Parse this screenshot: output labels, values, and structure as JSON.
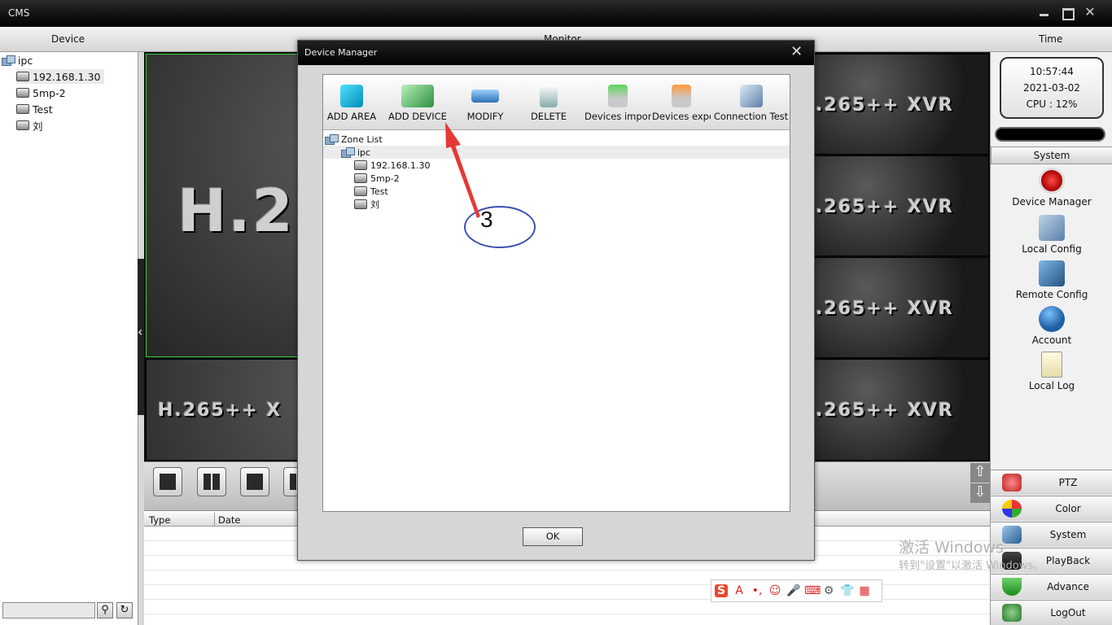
{
  "app": {
    "title": "CMS",
    "close_glyph": "✕"
  },
  "header": {
    "device": "Device",
    "monitor": "Monitor",
    "time": "Time"
  },
  "device_tree": {
    "root": "ipc",
    "items": [
      "192.168.1.30",
      "5mp-2",
      "Test",
      "刘"
    ]
  },
  "left_panel": {
    "search_icon": "search-icon",
    "refresh_icon": "refresh-icon"
  },
  "video_tiles": {
    "big_text": "H.2",
    "right_text": ".265++ XVR",
    "bottom_text": "H.265++ X"
  },
  "log_table": {
    "columns": [
      "Type",
      "Date"
    ]
  },
  "clock": {
    "time": "10:57:44",
    "date": "2021-03-02",
    "cpu": "CPU : 12%"
  },
  "system_panel": {
    "header": "System",
    "items": [
      "Device Manager",
      "Local Config",
      "Remote Config",
      "Account",
      "Local Log"
    ]
  },
  "bottom_buttons": [
    "PTZ",
    "Color",
    "System",
    "PlayBack",
    "Advance",
    "LogOut"
  ],
  "dialog": {
    "title": "Device Manager",
    "toolbar": [
      "ADD AREA",
      "ADD DEVICE",
      "MODIFY",
      "DELETE",
      "Devices import",
      "Devices expor",
      "Connection Test"
    ],
    "tree": {
      "root": "Zone List",
      "zone": "ipc",
      "devices": [
        "192.168.1.30",
        "5mp-2",
        "Test",
        "刘"
      ]
    },
    "ok": "OK"
  },
  "annotation": {
    "number": "3",
    "color": "#e53935",
    "ellipse_color": "#3b4fb0"
  },
  "watermark": {
    "line1": "激活 Windows",
    "line2": "转到\"设置\"以激活 Windows。"
  },
  "ime": {
    "logo": "S",
    "letter": "A"
  },
  "colors": {
    "accent_green": "#3bd13b",
    "dark": "#000000"
  }
}
